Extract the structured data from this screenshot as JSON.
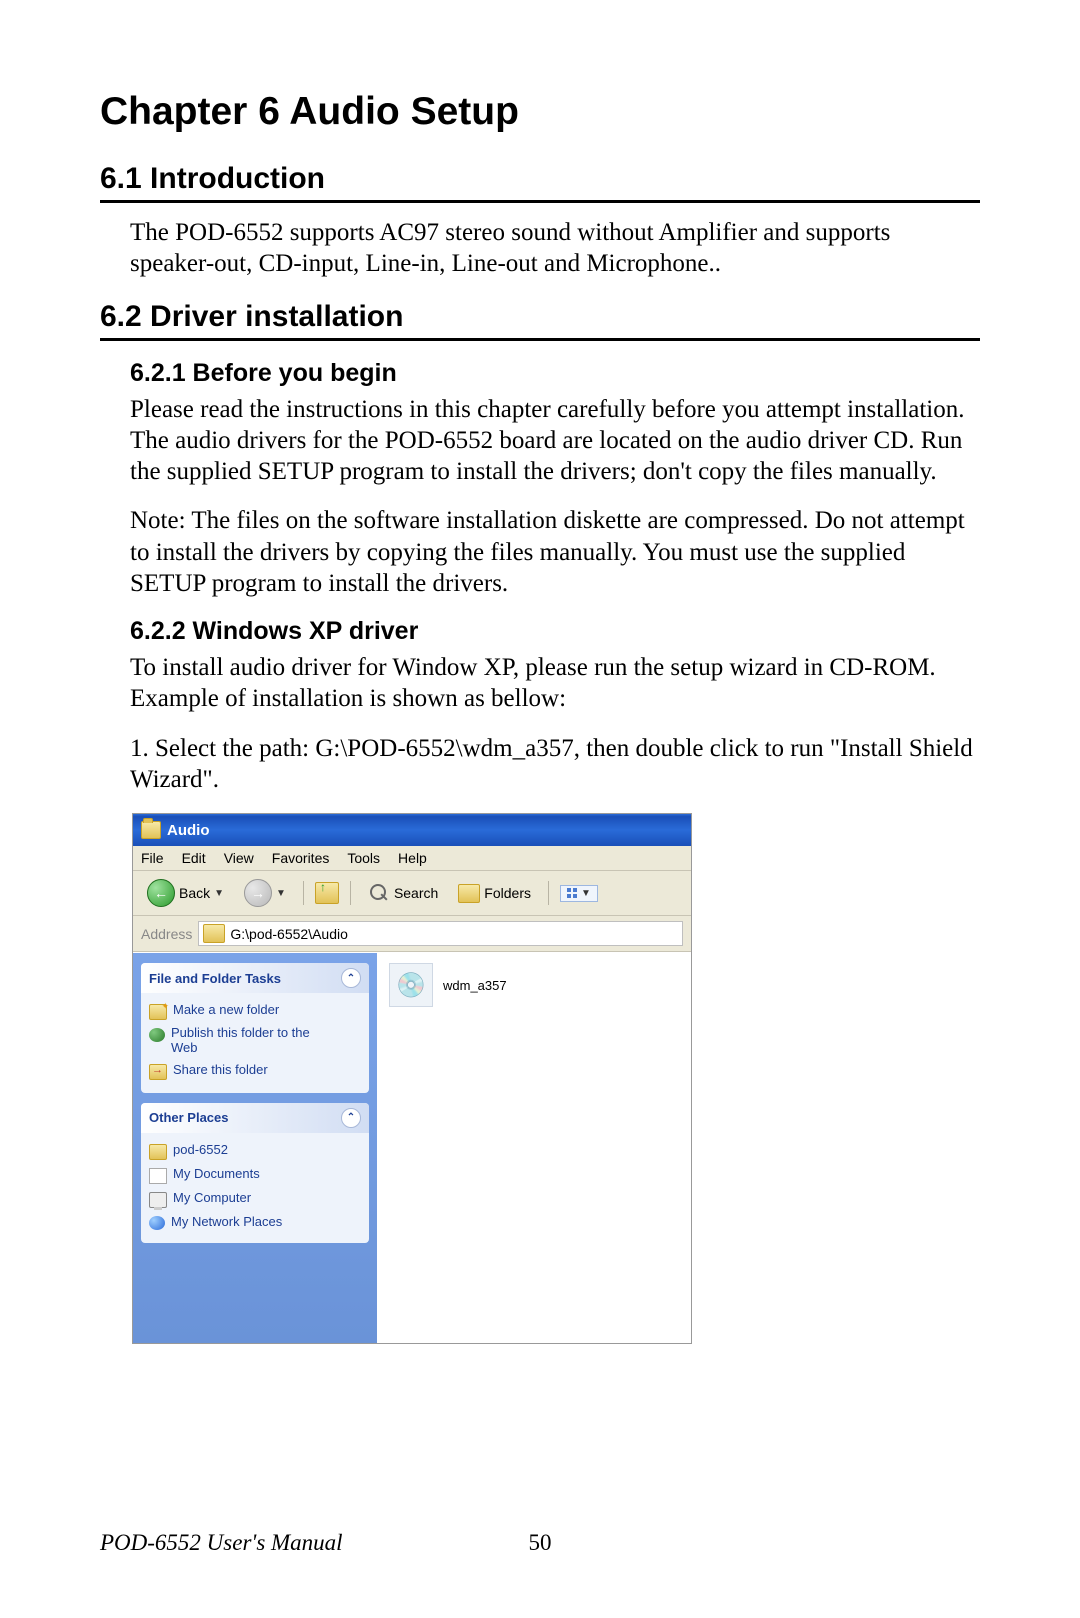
{
  "chapter_title": "Chapter 6  Audio Setup",
  "section_6_1": {
    "heading": "6.1  Introduction",
    "body": "The POD-6552 supports AC97 stereo sound without Amplifier and supports speaker-out, CD-input, Line-in, Line-out and Microphone.."
  },
  "section_6_2": {
    "heading": "6.2  Driver installation",
    "sub_6_2_1": {
      "heading": "6.2.1  Before you begin",
      "para1": "Please read the instructions in this chapter carefully before you attempt installation. The audio drivers for the POD-6552 board are located on the audio driver CD. Run the supplied SETUP program to install the drivers; don't copy the files manually.",
      "para2": "Note: The files on the software installation diskette are compressed. Do not attempt to install the drivers by copying the files manually. You must use the supplied SETUP program to install the drivers."
    },
    "sub_6_2_2": {
      "heading": "6.2.2  Windows XP driver",
      "para1": "To install audio driver for Window XP, please run the setup wizard in CD-ROM. Example of installation is shown as bellow:",
      "para2": "1. Select the path: G:\\POD-6552\\wdm_a357, then double click to run \"Install Shield Wizard\"."
    }
  },
  "xp": {
    "title": "Audio",
    "menu": {
      "file": "File",
      "edit": "Edit",
      "view": "View",
      "favorites": "Favorites",
      "tools": "Tools",
      "help": "Help"
    },
    "toolbar": {
      "back": "Back",
      "search": "Search",
      "folders": "Folders"
    },
    "address_label": "Address",
    "address_path": "G:\\pod-6552\\Audio",
    "panel1": {
      "title": "File and Folder Tasks",
      "t1": "Make a new folder",
      "t2a": "Publish this folder to the",
      "t2b": "Web",
      "t3": "Share this folder"
    },
    "panel2": {
      "title": "Other Places",
      "p1": "pod-6552",
      "p2": "My Documents",
      "p3": "My Computer",
      "p4": "My Network Places"
    },
    "content_file": "wdm_a357"
  },
  "footer": {
    "manual": "POD-6552 User's Manual",
    "page": "50"
  }
}
